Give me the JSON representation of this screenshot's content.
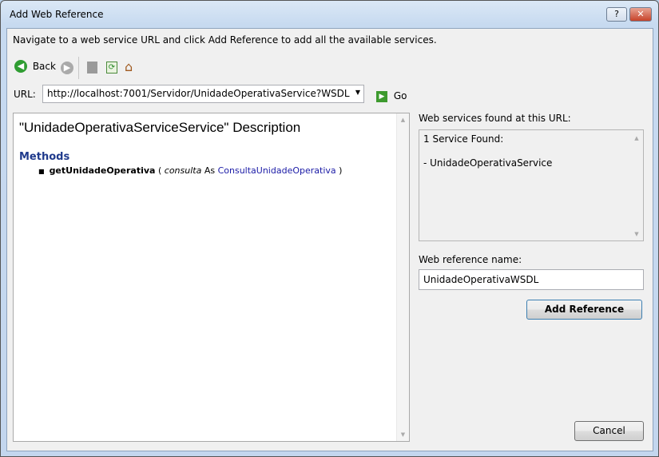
{
  "window": {
    "title": "Add Web Reference",
    "help": "?",
    "close": "✕"
  },
  "instruction": "Navigate to a web service URL and click Add Reference to add all the available services.",
  "toolbar": {
    "back": "Back"
  },
  "url": {
    "label": "URL:",
    "value": "http://localhost:7001/Servidor/UnidadeOperativaService?WSDL",
    "go": "Go"
  },
  "browser": {
    "heading": "\"UnidadeOperativaServiceService\" Description",
    "methods_title": "Methods",
    "method": {
      "name": "getUnidadeOperativa",
      "open": " ( ",
      "param": "consulta",
      "as": " As ",
      "type": "ConsultaUnidadeOperativa",
      "close": " )"
    }
  },
  "services": {
    "label": "Web services found at this URL:",
    "count": "1 Service Found:",
    "items": [
      "- UnidadeOperativaService"
    ]
  },
  "refname": {
    "label": "Web reference name:",
    "value": "UnidadeOperativaWSDL"
  },
  "buttons": {
    "add": "Add Reference",
    "cancel": "Cancel"
  },
  "colors": {
    "link": "#1a1aa6",
    "methods": "#1f3a8c"
  }
}
